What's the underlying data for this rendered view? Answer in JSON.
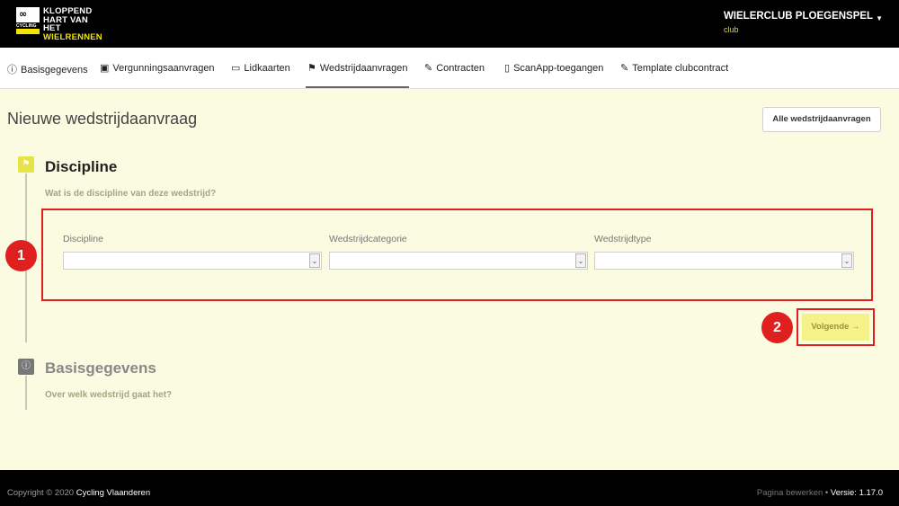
{
  "header": {
    "logo": {
      "glyph": "∞",
      "sub": "CYCLING",
      "line1": "KLOPPEND",
      "line2": "HART VAN HET",
      "line3": "WIELRENNEN"
    },
    "club_name": "WIELERCLUB PLOEGENSPEL",
    "club_role": "club"
  },
  "nav": {
    "items": [
      {
        "label": "Basisgegevens",
        "icon": "info-circle-icon",
        "glyph": "ⓘ"
      },
      {
        "label": "Vergunningsaanvragen",
        "icon": "badge-icon",
        "glyph": "▣"
      },
      {
        "label": "Lidkaarten",
        "icon": "card-icon",
        "glyph": "▭"
      },
      {
        "label": "Wedstrijdaanvragen",
        "icon": "flag-checkered-icon",
        "glyph": "⚑"
      },
      {
        "label": "Contracten",
        "icon": "signature-icon",
        "glyph": "✎"
      },
      {
        "label": "ScanApp-toegangen",
        "icon": "phone-icon",
        "glyph": "▯"
      },
      {
        "label": "Template clubcontract",
        "icon": "signature-icon",
        "glyph": "✎"
      }
    ],
    "active": "Wedstrijdaanvragen"
  },
  "main": {
    "title": "Nieuwe wedstrijdaanvraag",
    "all_button": "Alle wedstrijdaanvragen",
    "step1": {
      "title": "Discipline",
      "subtitle": "Wat is de discipline van deze wedstrijd?",
      "fields": [
        {
          "label": "Discipline",
          "value": ""
        },
        {
          "label": "Wedstrijdcategorie",
          "value": ""
        },
        {
          "label": "Wedstrijdtype",
          "value": ""
        }
      ]
    },
    "next_button": "Volgende →",
    "step2": {
      "title": "Basisgegevens",
      "subtitle": "Over welk wedstrijd gaat het?"
    },
    "annotations": {
      "badge1": "1",
      "badge2": "2"
    }
  },
  "footer": {
    "copyright_prefix": "Copyright © 2020",
    "brand": "Cycling Vlaanderen",
    "edit_link": "Pagina bewerken",
    "separator": "•",
    "version": "Versie: 1.17.0"
  },
  "colors": {
    "accent": "#f5e400",
    "highlight": "#e0201e",
    "background": "#fafbe0"
  }
}
